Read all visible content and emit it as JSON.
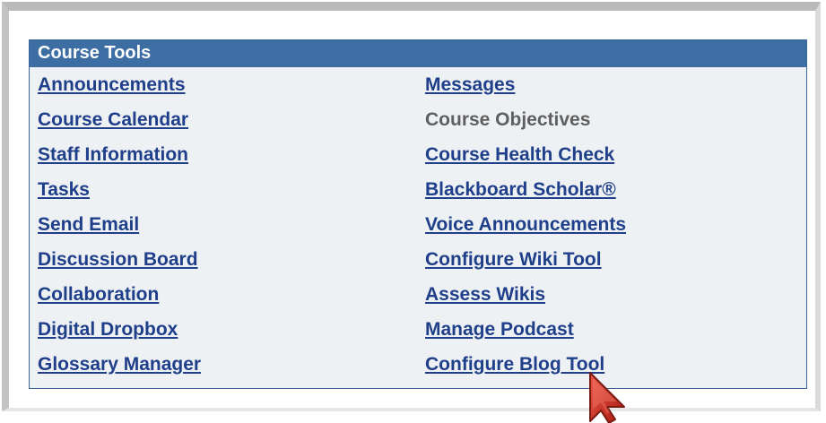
{
  "panel": {
    "title": "Course Tools",
    "left_links": [
      "Announcements",
      "Course Calendar",
      "Staff Information",
      "Tasks",
      "Send Email",
      "Discussion Board",
      "Collaboration",
      "Digital Dropbox",
      "Glossary Manager"
    ],
    "right_links": [
      "Messages",
      "Course Objectives",
      "Course Health Check",
      "Blackboard Scholar®",
      "Voice Announcements",
      "Configure Wiki Tool",
      "Assess Wikis",
      "Manage Podcast",
      "Configure Blog Tool"
    ]
  },
  "colors": {
    "header_bg": "#3c6da3",
    "link": "#1f3f8a",
    "disabled_text": "#5f5f5f",
    "panel_bg": "#eef1f4"
  },
  "icons": {
    "cursor": "mouse-pointer-icon"
  }
}
